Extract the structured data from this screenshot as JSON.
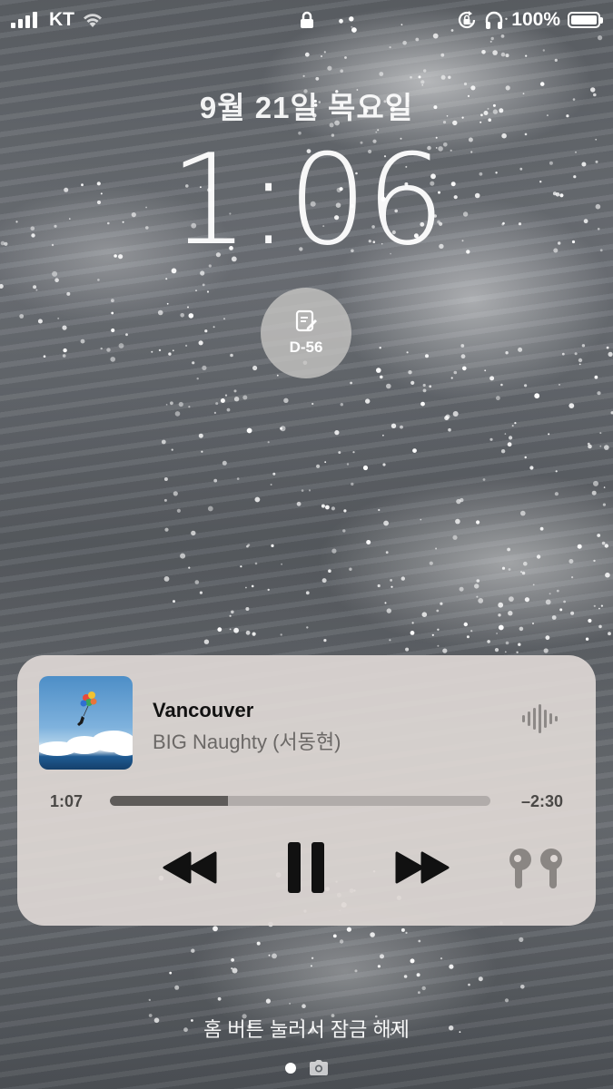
{
  "status_bar": {
    "carrier": "KT",
    "battery_percent": "100%",
    "battery_level": 1.0
  },
  "lock_screen": {
    "date": "9월 21일 목요일",
    "time": "1:06",
    "widget_label": "D-56",
    "unlock_hint": "홈 버튼 눌러서 잠금 해제"
  },
  "player": {
    "title": "Vancouver",
    "artist": "BIG Naughty (서동현)",
    "elapsed": "1:07",
    "remaining": "–2:30",
    "progress": 0.31
  },
  "icons": {
    "status": [
      "signal-icon",
      "wifi-icon",
      "lock-icon",
      "orientation-lock-icon",
      "headphones-icon",
      "battery-icon"
    ],
    "widget": "note-icon",
    "player": [
      "waveform-icon",
      "rewind-icon",
      "pause-icon",
      "fast-forward-icon",
      "airpods-icon"
    ],
    "bottom": [
      "page-dot",
      "camera-icon"
    ]
  },
  "colors": {
    "player_bg": "#ded8d5",
    "progress_fill": "#5e5b59",
    "progress_track": "#b1acaa"
  }
}
